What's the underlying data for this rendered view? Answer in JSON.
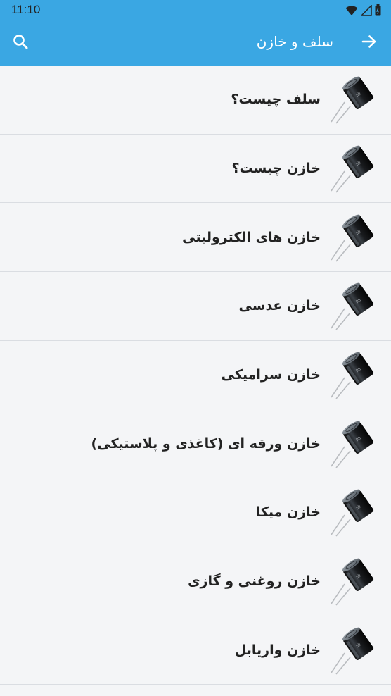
{
  "status_bar": {
    "time": "11:10",
    "icons": [
      "wifi-icon",
      "signal-icon",
      "battery-icon"
    ]
  },
  "app_bar": {
    "title": "سلف و خازن",
    "back_icon": "arrow-right-icon",
    "search_icon": "search-icon"
  },
  "list": {
    "item_icon": "capacitor-icon",
    "items": [
      {
        "label": "سلف چیست؟"
      },
      {
        "label": "خازن چیست؟"
      },
      {
        "label": "خازن های الکترولیتی"
      },
      {
        "label": "خازن عدسی"
      },
      {
        "label": "خازن سرامیکی"
      },
      {
        "label": "خازن ورقه ای (کاغذی و پلاستیکی)"
      },
      {
        "label": "خازن میکا"
      },
      {
        "label": "خازن روغنی و گازی"
      },
      {
        "label": "خازن واریابل"
      }
    ]
  },
  "colors": {
    "primary": "#3aa7e3",
    "background": "#f4f5f7",
    "divider": "#dadde2",
    "text": "#222222"
  }
}
